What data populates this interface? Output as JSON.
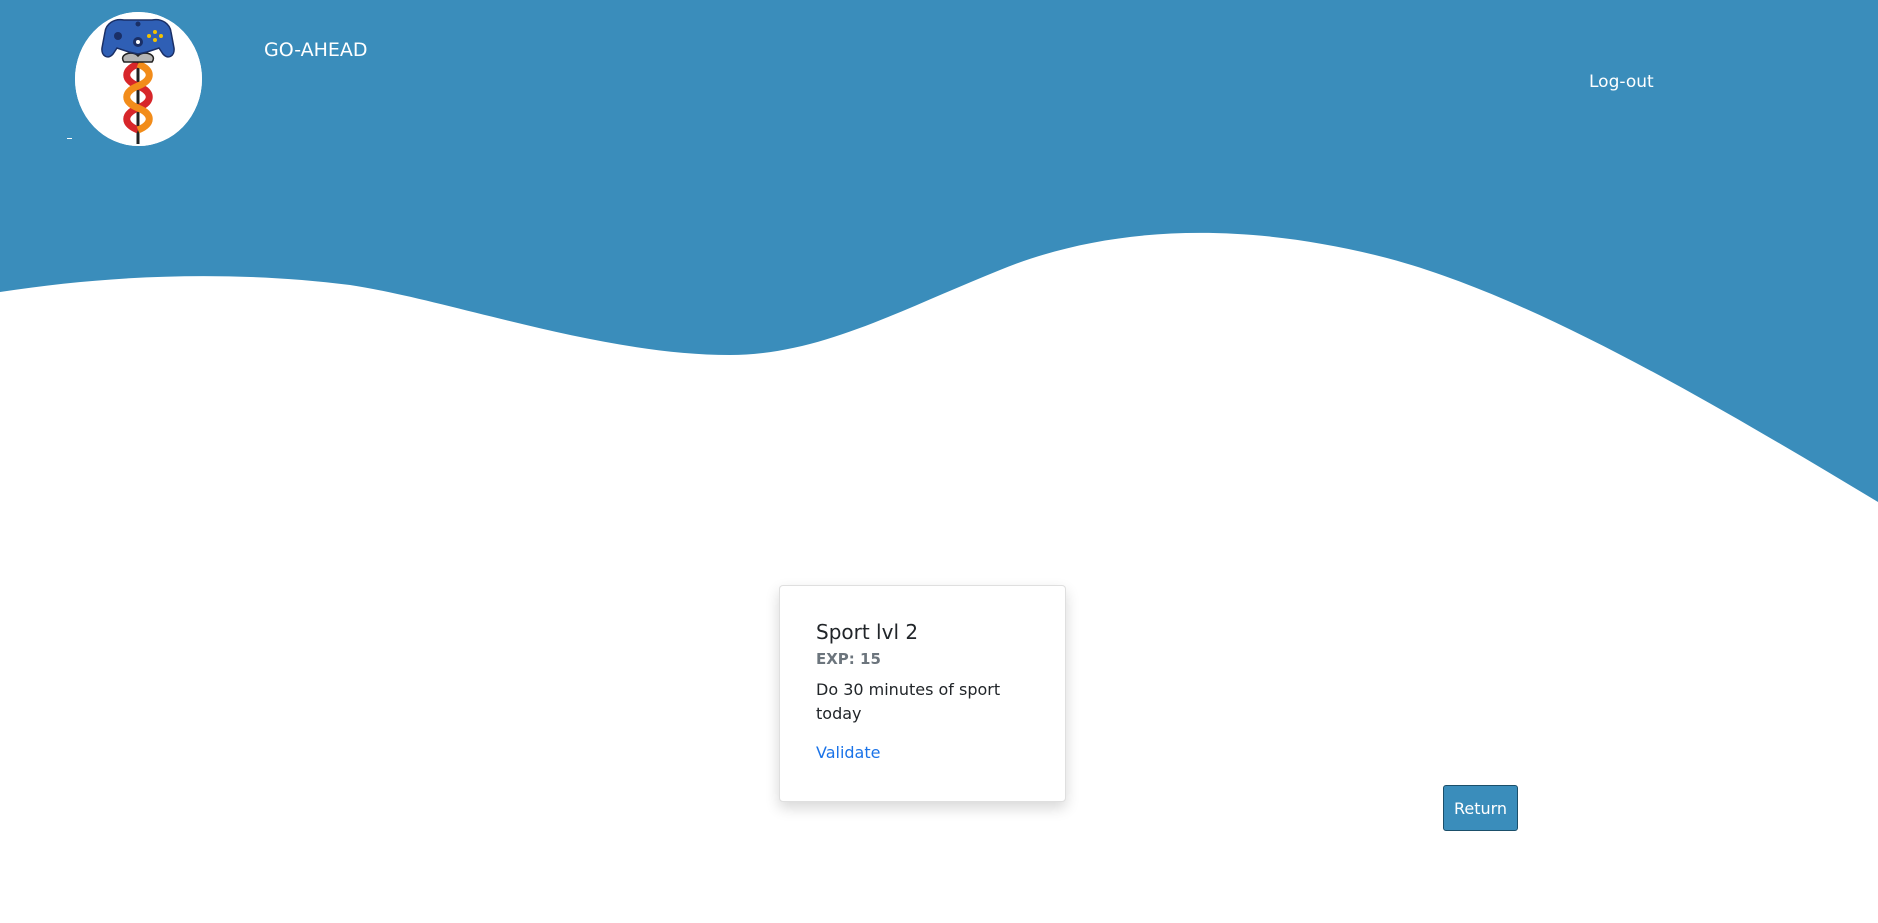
{
  "header": {
    "brand": "GO-AHEAD",
    "logout_label": "Log-out",
    "logo_icon": "controller-caduceus-logo"
  },
  "colors": {
    "primary_blue": "#3a8dbb",
    "link_blue": "#1a73e8",
    "text_dark": "#212529",
    "text_muted": "#6c757d"
  },
  "quest_card": {
    "title": "Sport lvl 2",
    "exp": "EXP: 15",
    "description": "Do 30 minutes of sport today",
    "action_label": "Validate"
  },
  "return_label": "Return"
}
